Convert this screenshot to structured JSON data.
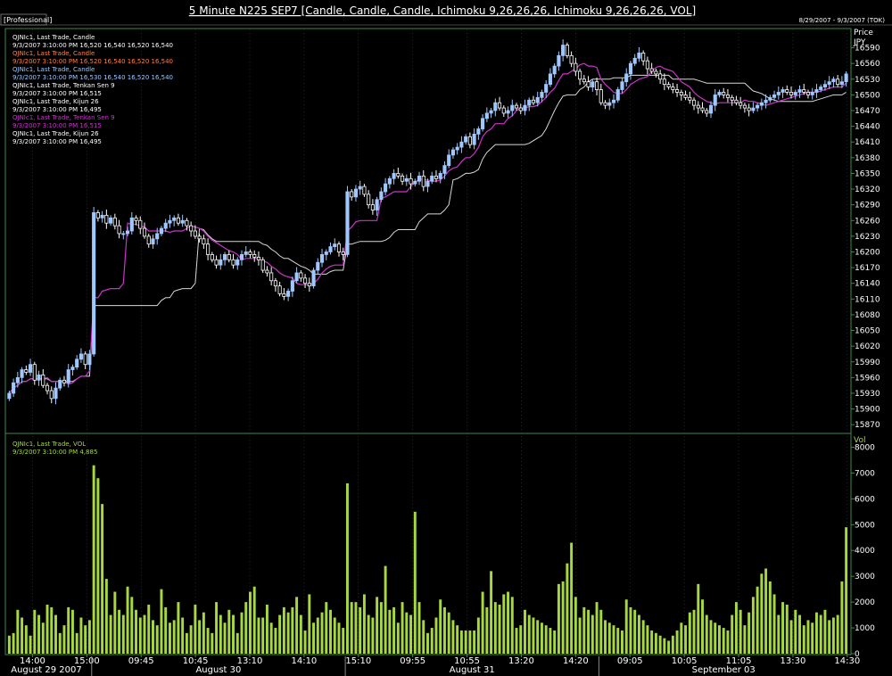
{
  "header": {
    "badge": "[Professional]",
    "title": "5 Minute N225 SEP7 [Candle, Candle, Candle, Ichimoku 9,26,26,26, Ichimoku 9,26,26,26, VOL]",
    "date_range": "8/29/2007 - 9/3/2007 (TOK)"
  },
  "legend_price": [
    {
      "text": "QJNIc1, Last Trade, Candle",
      "color": "#ffffff"
    },
    {
      "text": "9/3/2007 3:10:00 PM 16,520 16,540 16,520 16,540",
      "color": "#ffffff"
    },
    {
      "text": "QJNIc1, Last Trade, Candle",
      "color": "#ff8040"
    },
    {
      "text": "9/3/2007 3:10:00 PM 16,520 16,540 16,520 16,540",
      "color": "#ff8040"
    },
    {
      "text": "QJNIc1, Last Trade, Candle",
      "color": "#9ec8ff"
    },
    {
      "text": "9/3/2007 3:10:00 PM 16,530 16,540 16,520 16,540",
      "color": "#9ec8ff"
    },
    {
      "text": "QJNIc1, Last Trade, Tenkan Sen 9",
      "color": "#ffffff"
    },
    {
      "text": "9/3/2007 3:10:00 PM 16,515",
      "color": "#ffffff"
    },
    {
      "text": "QJNIc1, Last Trade, Kijun 26",
      "color": "#ffffff"
    },
    {
      "text": "9/3/2007 3:10:00 PM 16,495",
      "color": "#ffffff"
    },
    {
      "text": "QJNIc1, Last Trade, Tenkan Sen 9",
      "color": "#cc33cc"
    },
    {
      "text": "9/3/2007 3:10:00 PM 16,515",
      "color": "#cc33cc"
    },
    {
      "text": "QJNIc1, Last Trade, Kijun 26",
      "color": "#ffffff"
    },
    {
      "text": "9/3/2007 3:10:00 PM 16,495",
      "color": "#ffffff"
    }
  ],
  "legend_volume": [
    {
      "text": "QJNIc1, Last Trade, VOL",
      "color": "#a8d840"
    },
    {
      "text": "9/3/2007 3:10:00 PM 4,885",
      "color": "#a8d840"
    }
  ],
  "colors": {
    "candle_up": "#9ec8ff",
    "candle_down": "#ffffff",
    "tenkan": "#cc33cc",
    "kijun": "#d8d8d8",
    "volume": "#a8d840",
    "grid": "#1f5a2e",
    "border": "#3c8a4a"
  },
  "chart_data": {
    "type": "candlestick",
    "price_axis": {
      "label": "Price",
      "unit": "JPY",
      "ticks": [
        15870,
        15900,
        15930,
        15960,
        15990,
        16020,
        16050,
        16080,
        16110,
        16140,
        16170,
        16200,
        16230,
        16260,
        16290,
        16320,
        16350,
        16380,
        16410,
        16440,
        16470,
        16500,
        16530,
        16560,
        16590
      ],
      "range": [
        15855,
        16625
      ]
    },
    "volume_axis": {
      "label": "Vol",
      "ticks": [
        0,
        1000,
        2000,
        3000,
        4000,
        5000,
        6000,
        7000,
        8000
      ],
      "range": [
        0,
        8500
      ]
    },
    "time_ticks": [
      "14:00",
      "15:00",
      "09:45",
      "10:45",
      "13:10",
      "14:10",
      "15:10",
      "09:55",
      "10:55",
      "13:20",
      "14:20",
      "09:05",
      "10:05",
      "11:05",
      "13:30",
      "14:30"
    ],
    "day_labels": [
      "August 29 2007",
      "August 30",
      "August 31",
      "September 03"
    ],
    "close": [
      15930,
      15950,
      15960,
      15975,
      15970,
      15985,
      15955,
      15965,
      15945,
      15935,
      15920,
      15940,
      15955,
      15950,
      15975,
      15980,
      15995,
      16005,
      15985,
      16005,
      16275,
      16265,
      16270,
      16255,
      16265,
      16250,
      16235,
      16235,
      16240,
      16265,
      16260,
      16245,
      16230,
      16215,
      16225,
      16235,
      16245,
      16255,
      16260,
      16265,
      16255,
      16260,
      16250,
      16240,
      16230,
      16225,
      16215,
      16195,
      16185,
      16175,
      16185,
      16195,
      16185,
      16175,
      16185,
      16195,
      16200,
      16195,
      16190,
      16185,
      16165,
      16160,
      16145,
      16135,
      16120,
      16115,
      16125,
      16145,
      16160,
      16150,
      16140,
      16135,
      16165,
      16180,
      16195,
      16200,
      16210,
      16215,
      16200,
      16195,
      16315,
      16305,
      16320,
      16325,
      16310,
      16290,
      16280,
      16300,
      16315,
      16330,
      16340,
      16350,
      16345,
      16335,
      16340,
      16330,
      16335,
      16345,
      16325,
      16335,
      16345,
      16340,
      16350,
      16365,
      16385,
      16395,
      16400,
      16410,
      16420,
      16405,
      16425,
      16435,
      16455,
      16465,
      16470,
      16485,
      16475,
      16465,
      16470,
      16480,
      16475,
      16470,
      16480,
      16490,
      16485,
      16495,
      16505,
      16520,
      16540,
      16555,
      16575,
      16595,
      16575,
      16560,
      16545,
      16530,
      16525,
      16515,
      16525,
      16510,
      16485,
      16480,
      16485,
      16490,
      16510,
      16525,
      16540,
      16560,
      16570,
      16580,
      16565,
      16550,
      16545,
      16540,
      16530,
      16520,
      16515,
      16510,
      16505,
      16500,
      16495,
      16490,
      16480,
      16475,
      16470,
      16465,
      16480,
      16500,
      16505,
      16500,
      16495,
      16490,
      16485,
      16480,
      16475,
      16470,
      16475,
      16480,
      16485,
      16490,
      16495,
      16500,
      16505,
      16510,
      16505,
      16500,
      16505,
      16510,
      16505,
      16500,
      16505,
      16510,
      16515,
      16520,
      16525,
      16530,
      16520,
      16525,
      16540
    ],
    "volume": [
      700,
      800,
      1700,
      1400,
      1100,
      700,
      1700,
      1500,
      1200,
      1900,
      1800,
      1500,
      800,
      1100,
      1800,
      1700,
      800,
      1400,
      1100,
      1300,
      7300,
      6800,
      5800,
      2900,
      1500,
      2400,
      1700,
      1500,
      2600,
      2200,
      1700,
      1400,
      1500,
      1900,
      1300,
      1100,
      2500,
      1800,
      1200,
      1300,
      2000,
      1400,
      800,
      1100,
      1900,
      1300,
      1600,
      1000,
      800,
      2000,
      1500,
      1200,
      1700,
      1500,
      800,
      1600,
      2000,
      2400,
      2600,
      1400,
      1400,
      1900,
      1200,
      1000,
      1500,
      1800,
      1600,
      1800,
      2200,
      1500,
      900,
      2300,
      1200,
      1400,
      1600,
      2000,
      1700,
      1400,
      1200,
      1000,
      6600,
      2000,
      2000,
      1800,
      2300,
      1500,
      1400,
      2200,
      2000,
      3400,
      1700,
      1800,
      1200,
      2000,
      1600,
      1500,
      5500,
      2000,
      1300,
      800,
      1000,
      1400,
      2100,
      1800,
      1600,
      1300,
      1100,
      900,
      900,
      900,
      900,
      1400,
      2400,
      1800,
      3200,
      2000,
      1900,
      2300,
      2400,
      2200,
      1000,
      1100,
      1700,
      1500,
      1400,
      1300,
      1200,
      1100,
      1000,
      900,
      2700,
      2800,
      3500,
      4300,
      2200,
      1400,
      1800,
      1700,
      1500,
      2000,
      1700,
      1300,
      1200,
      1100,
      1000,
      900,
      2100,
      1800,
      1700,
      1500,
      1300,
      1100,
      900,
      800,
      700,
      600,
      500,
      700,
      900,
      1200,
      1100,
      1600,
      1700,
      2700,
      2100,
      1500,
      1300,
      1200,
      1100,
      1000,
      900,
      1500,
      2000,
      1700,
      1100,
      1600,
      2200,
      2600,
      3100,
      3300,
      2800,
      2300,
      1500,
      2000,
      1900,
      1300,
      1700,
      1500,
      1100,
      1300,
      1200,
      1600,
      1500,
      1700,
      1300,
      1400,
      1500,
      2800,
      4900
    ]
  }
}
